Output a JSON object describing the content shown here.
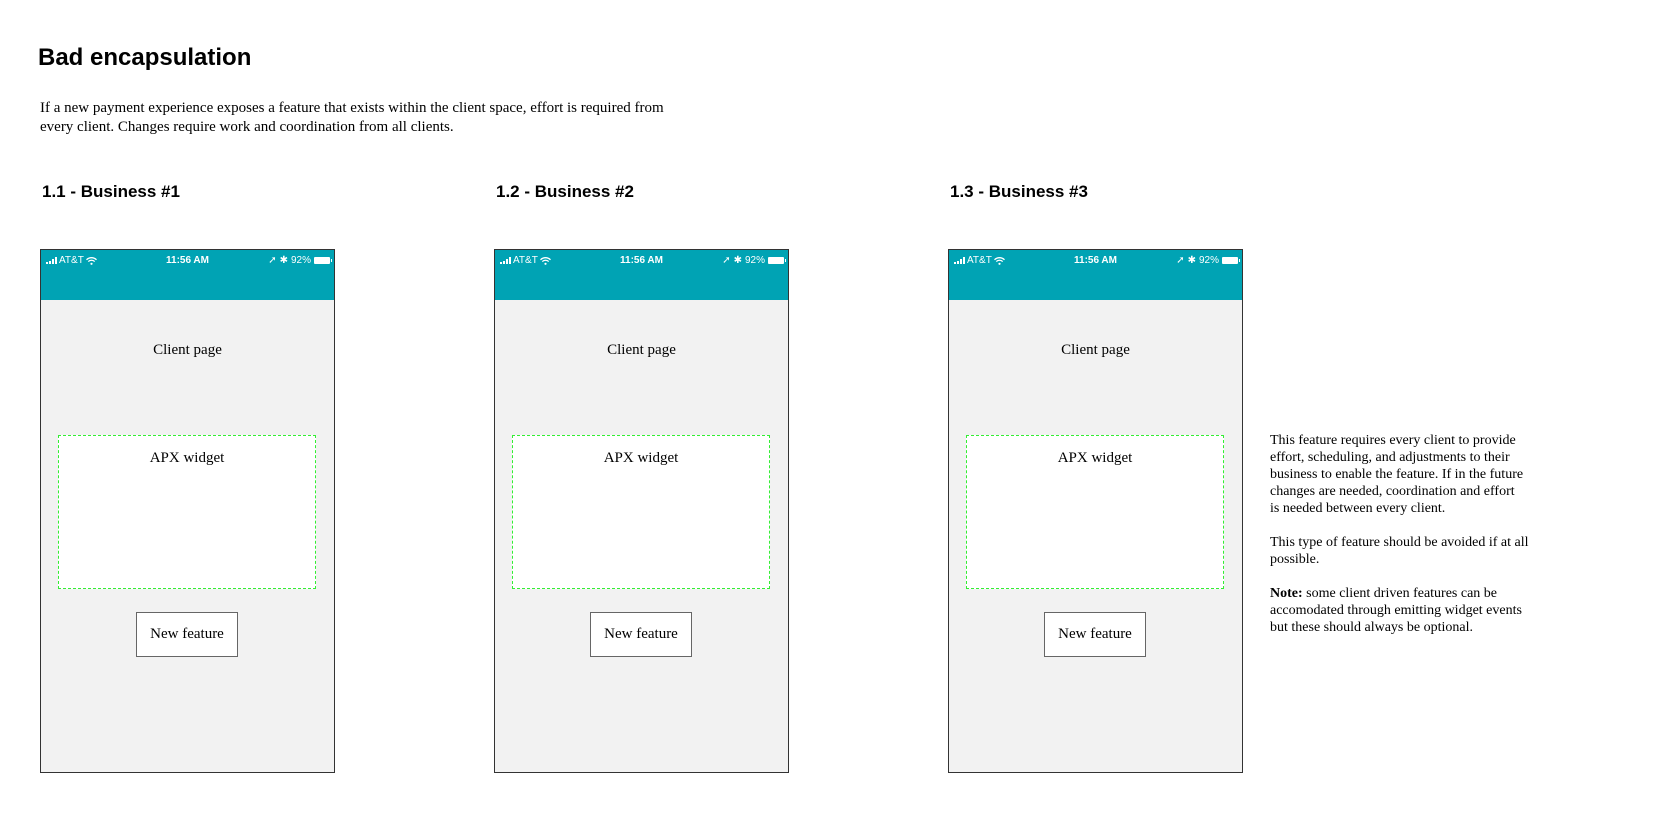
{
  "title": "Bad encapsulation",
  "intro": "If a new payment experience exposes a feature that exists within the client space, effort is required from\nevery client.  Changes require work and coordination from all clients.",
  "status_bar": {
    "carrier": "AT&T",
    "time": "11:56 AM",
    "battery": "92%",
    "location_glyph": "➚",
    "bluetooth_glyph": "✱",
    "color": "#00a3b4"
  },
  "sections": [
    {
      "heading": "1.1 - Business #1",
      "client_page_label": "Client page",
      "widget_label": "APX widget",
      "feature_button_label": "New feature"
    },
    {
      "heading": "1.2 - Business #2",
      "client_page_label": "Client page",
      "widget_label": "APX widget",
      "feature_button_label": "New feature"
    },
    {
      "heading": "1.3 - Business #3",
      "client_page_label": "Client page",
      "widget_label": "APX widget",
      "feature_button_label": "New feature"
    }
  ],
  "note": {
    "paragraph1": "This feature requires every client to provide\neffort, scheduling, and adjustments to their\nbusiness to enable the feature.  If in the future\nchanges are needed, coordination and effort\nis needed between every client.",
    "paragraph2": "This type of feature should be avoided if at all\npossible.",
    "note_label": "Note:",
    "paragraph3": " some client driven features can be\naccomodated through emitting widget events\nbut these should always be optional."
  }
}
